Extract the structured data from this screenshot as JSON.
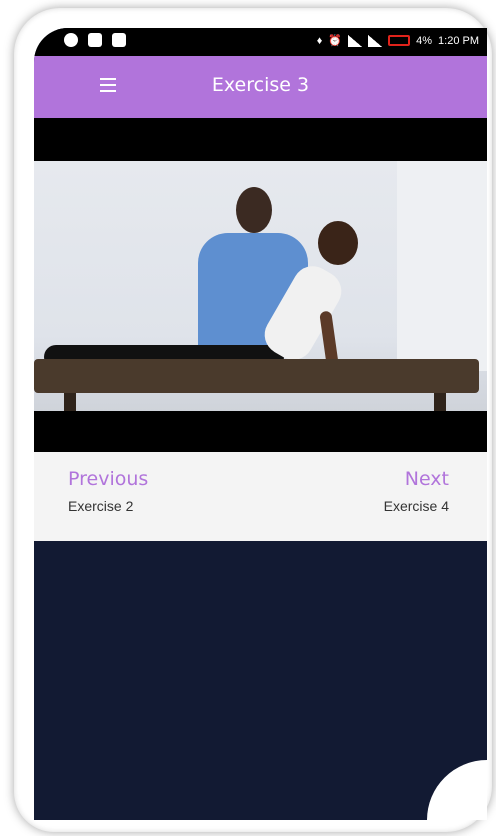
{
  "status_bar": {
    "battery_text": "4%",
    "time": "1:20 PM",
    "left_icons": [
      "vpn-icon",
      "image-icon",
      "message-icon"
    ],
    "right_icons": [
      "vibrate-icon",
      "alarm-icon",
      "signal-icon",
      "signal-icon",
      "battery-icon"
    ],
    "battery_color": "#e0231b"
  },
  "app_bar": {
    "title": "Exercise 3",
    "menu_icon": "hamburger-menu-icon",
    "color": "#b174db"
  },
  "video": {
    "description_icon": "video-thumbnail"
  },
  "navigation": {
    "previous_label": "Previous",
    "previous_exercise": "Exercise 2",
    "next_label": "Next",
    "next_exercise": "Exercise 4",
    "accent_color": "#b174db"
  },
  "body": {
    "background_color": "#121a33"
  }
}
